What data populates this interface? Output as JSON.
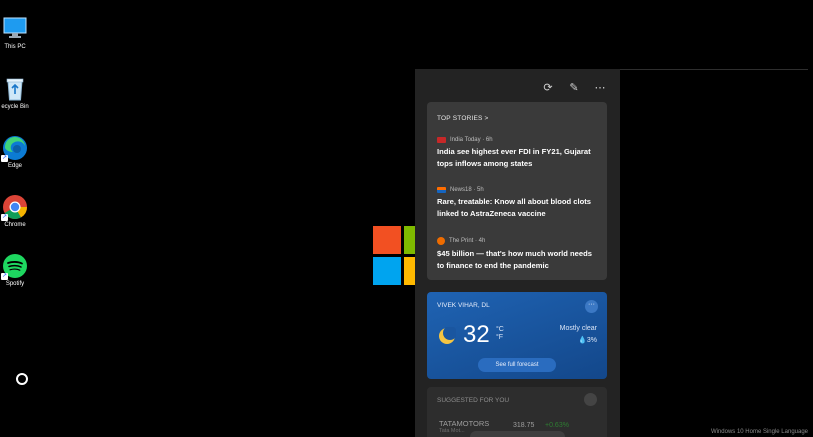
{
  "desktop_icons": [
    {
      "label": "This PC",
      "icon": "monitor-icon"
    },
    {
      "label": "ecycle Bin",
      "icon": "recycle-bin-icon"
    },
    {
      "label": "Edge",
      "icon": "edge-icon"
    },
    {
      "label": "Chrome",
      "icon": "chrome-icon"
    },
    {
      "label": "Spotify",
      "icon": "spotify-icon"
    }
  ],
  "widget_panel": {
    "toolbar": {
      "refresh": "⟳",
      "edit": "✎",
      "more": "⋯"
    },
    "top_stories": {
      "heading": "TOP STORIES >",
      "items": [
        {
          "source": "India Today · 6h",
          "title": "India see highest ever FDI in FY21, Gujarat tops inflows among states"
        },
        {
          "source": "News18 · 5h",
          "title": "Rare, treatable: Know all about blood clots linked to AstraZeneca vaccine"
        },
        {
          "source": "The Print · 4h",
          "title": "$45 billion — that's how much world needs to finance to end the pandemic"
        }
      ]
    },
    "weather": {
      "location": "VIVEK VIHAR, DL",
      "more": "···",
      "temperature": "32",
      "unit_c": "°C",
      "unit_f": "°F",
      "condition": "Mostly clear",
      "precipitation": "💧3%",
      "forecast_button": "See full forecast"
    },
    "suggested": {
      "heading": "SUGGESTED FOR YOU",
      "ticker": "TATAMOTORS",
      "ticker_sub": "Tata Mot...",
      "price": "318.75",
      "change": "+0.63%"
    }
  },
  "watermark": "Windows 10 Home Single Language",
  "colors": {
    "ms_red": "#f25022",
    "ms_green": "#7fba00",
    "ms_blue": "#00a4ef",
    "ms_yellow": "#ffb900"
  }
}
